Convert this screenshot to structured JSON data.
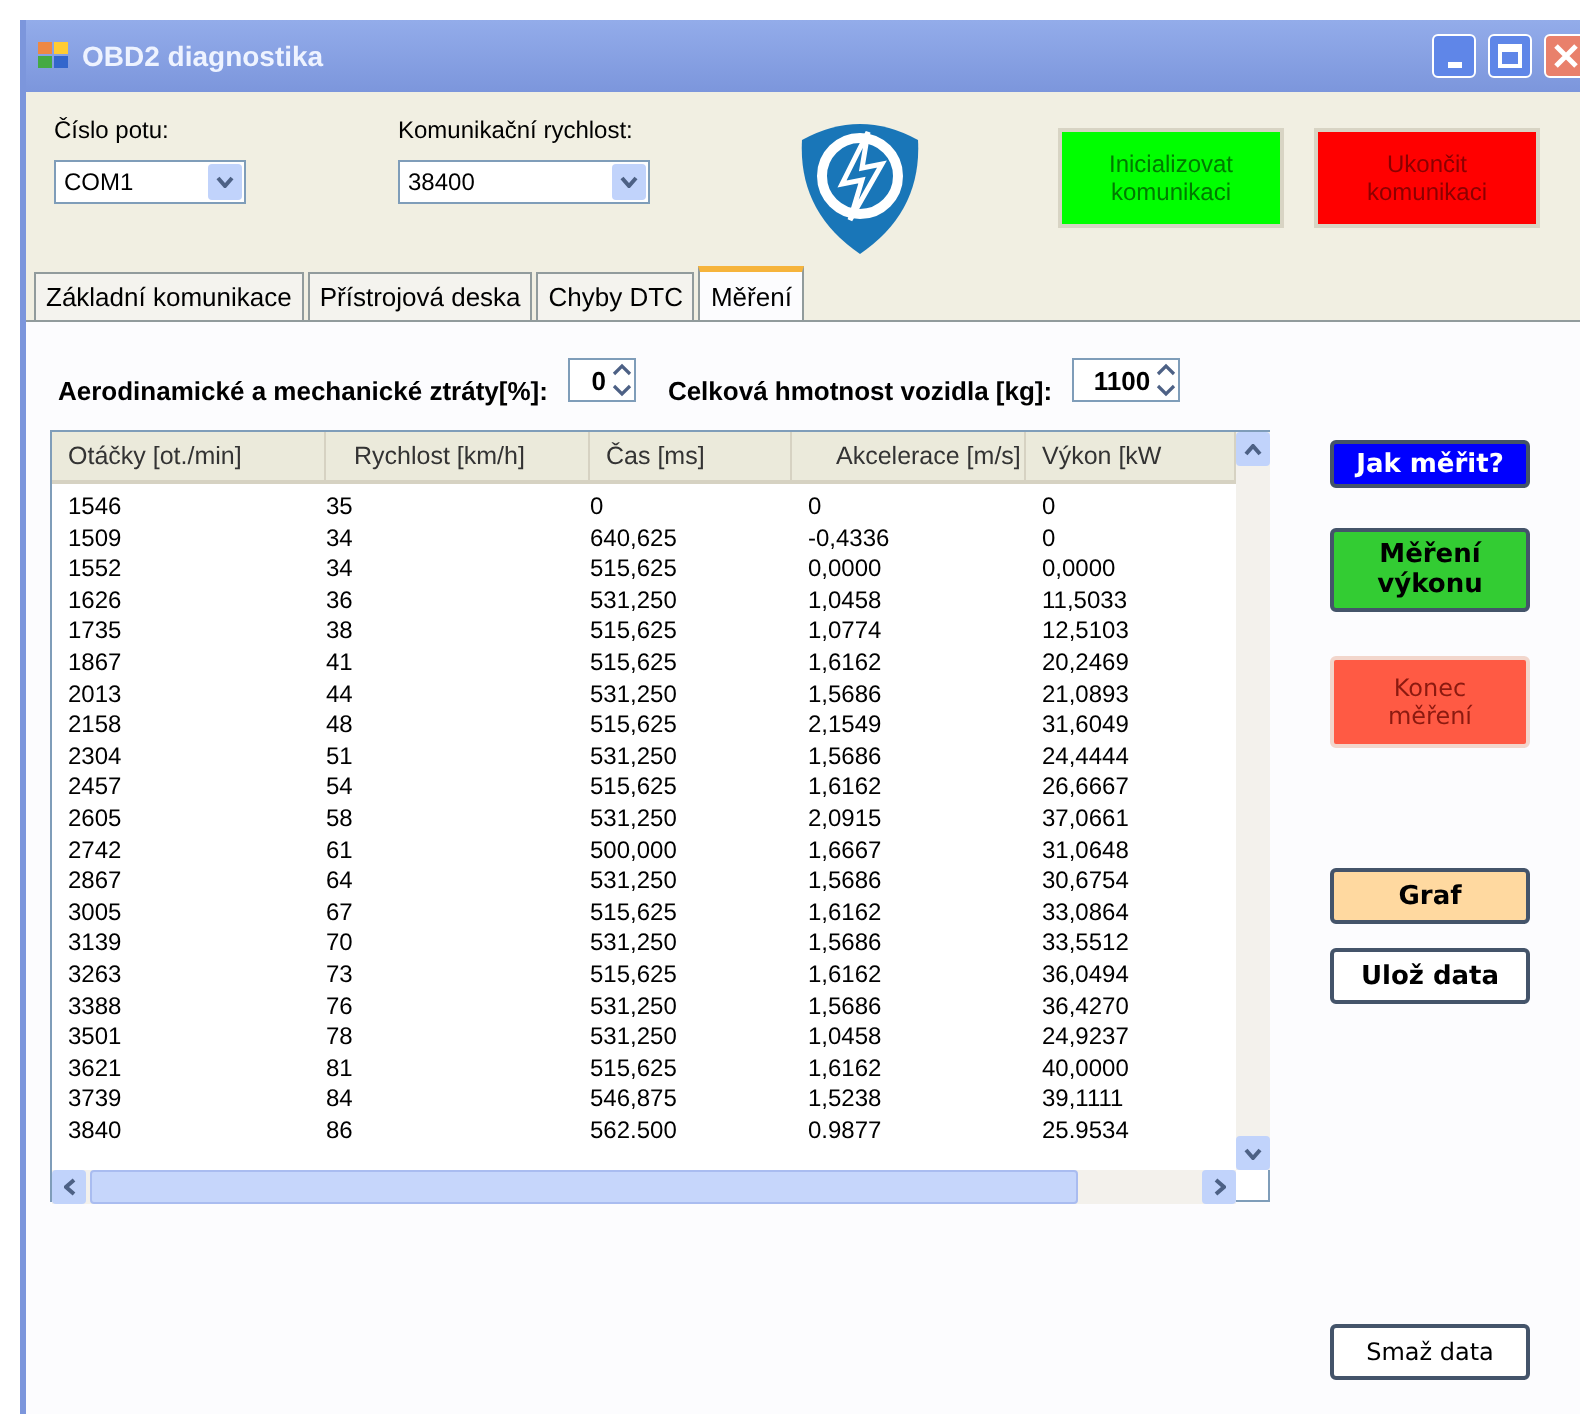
{
  "window": {
    "title": "OBD2 diagnostika"
  },
  "port": {
    "label": "Číslo potu:",
    "value": "COM1"
  },
  "speed": {
    "label": "Komunikační rychlost:",
    "value": "38400"
  },
  "connect_buttons": [
    {
      "label": "Inicializovat komunikaci",
      "color": "#00ff00"
    },
    {
      "label": "Ukončit komunikaci",
      "color": "#ff0000"
    }
  ],
  "tabs": [
    {
      "label": "Základní komunikace",
      "selected": false
    },
    {
      "label": "Přístrojová deska",
      "selected": false
    },
    {
      "label": "Chyby DTC",
      "selected": false
    },
    {
      "label": "Měření",
      "selected": true
    }
  ],
  "losses": {
    "label": "Aerodinamické a mechanické ztráty[%]:",
    "value": "0"
  },
  "mass": {
    "label": "Celková hmotnost vozidla [kg]:",
    "value": "1100"
  },
  "table": {
    "columns": [
      "Otáčky [ot./min]",
      "Rychlost [km/h]",
      "Čas [ms]",
      "Akcelerace [m/s]",
      "Výkon [kW"
    ],
    "rows": [
      [
        "1546",
        "35",
        "0",
        "0",
        "0"
      ],
      [
        "1509",
        "34",
        "640,625",
        "-0,4336",
        "0"
      ],
      [
        "1552",
        "34",
        "515,625",
        "0,0000",
        "0,0000"
      ],
      [
        "1626",
        "36",
        "531,250",
        "1,0458",
        "11,5033"
      ],
      [
        "1735",
        "38",
        "515,625",
        "1,0774",
        "12,5103"
      ],
      [
        "1867",
        "41",
        "515,625",
        "1,6162",
        "20,2469"
      ],
      [
        "2013",
        "44",
        "531,250",
        "1,5686",
        "21,0893"
      ],
      [
        "2158",
        "48",
        "515,625",
        "2,1549",
        "31,6049"
      ],
      [
        "2304",
        "51",
        "531,250",
        "1,5686",
        "24,4444"
      ],
      [
        "2457",
        "54",
        "515,625",
        "1,6162",
        "26,6667"
      ],
      [
        "2605",
        "58",
        "531,250",
        "2,0915",
        "37,0661"
      ],
      [
        "2742",
        "61",
        "500,000",
        "1,6667",
        "31,0648"
      ],
      [
        "2867",
        "64",
        "531,250",
        "1,5686",
        "30,6754"
      ],
      [
        "3005",
        "67",
        "515,625",
        "1,6162",
        "33,0864"
      ],
      [
        "3139",
        "70",
        "531,250",
        "1,5686",
        "33,5512"
      ],
      [
        "3263",
        "73",
        "515,625",
        "1,6162",
        "36,0494"
      ],
      [
        "3388",
        "76",
        "531,250",
        "1,5686",
        "36,4270"
      ],
      [
        "3501",
        "78",
        "531,250",
        "1,0458",
        "24,9237"
      ],
      [
        "3621",
        "81",
        "515,625",
        "1,6162",
        "40,0000"
      ],
      [
        "3739",
        "84",
        "546,875",
        "1,5238",
        "39,1111"
      ],
      [
        "3840",
        "86",
        "562.500",
        "0.9877",
        "25.9534"
      ]
    ]
  },
  "side_buttons": [
    {
      "label": "Jak měřit?",
      "color": "#0000ff",
      "bold": true
    },
    {
      "label": "Měření výkonu",
      "color": "#33cc33",
      "bold": true
    },
    {
      "label": "Konec měření",
      "color": "#ff5a44",
      "bold": false
    },
    {
      "label": "Graf",
      "color": "#ffd9a0",
      "bold": true
    },
    {
      "label": "Ulož data",
      "color": "#ffffff",
      "bold": true
    },
    {
      "label": "Smaž data",
      "color": "#ffffff",
      "bold": false
    }
  ]
}
